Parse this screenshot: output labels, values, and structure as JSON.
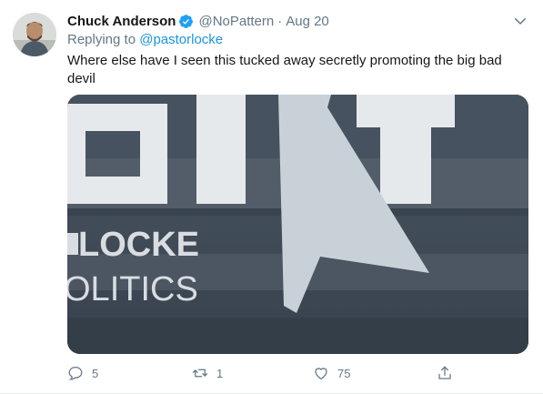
{
  "tweet": {
    "author_name": "Chuck Anderson",
    "author_handle": "@NoPattern",
    "separator": "·",
    "date": "Aug 20",
    "replying_prefix": "Replying to",
    "replying_to": "@pastorlocke",
    "text": "Where else have I seen this tucked away secretly promoting the big bad devil",
    "media": {
      "sign_text_top": "OI",
      "sign_text_top_right": "T",
      "sign_text_line1": "LOCKE",
      "sign_text_line2": "OLITICS"
    },
    "actions": {
      "replies": "5",
      "retweets": "1",
      "likes": "75"
    }
  },
  "colors": {
    "primary_text": "#14171a",
    "secondary_text": "#657786",
    "link": "#1b95e0",
    "verified_badge": "#1da1f2",
    "divider": "#e6ecf0"
  },
  "icons": {
    "verified": "verified-badge-icon",
    "caret": "chevron-down-icon",
    "reply": "reply-bubble-icon",
    "retweet": "retweet-icon",
    "like": "heart-icon",
    "share": "share-icon"
  }
}
